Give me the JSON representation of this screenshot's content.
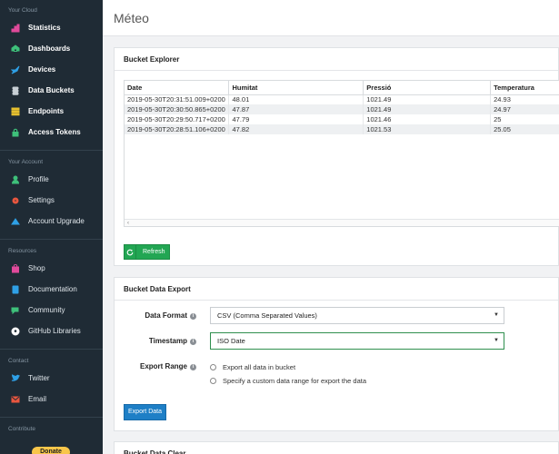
{
  "sidebar": {
    "your_cloud": {
      "title": "Your Cloud",
      "items": [
        {
          "label": "Statistics",
          "icon": "chart-icon",
          "color": "#e04a9b"
        },
        {
          "label": "Dashboards",
          "icon": "dashboard-icon",
          "color": "#3ec07a"
        },
        {
          "label": "Devices",
          "icon": "rocket-icon",
          "color": "#2fa0e6"
        },
        {
          "label": "Data Buckets",
          "icon": "database-icon",
          "color": "#c7cfd5"
        },
        {
          "label": "Endpoints",
          "icon": "list-icon",
          "color": "#e6c02f"
        },
        {
          "label": "Access Tokens",
          "icon": "lock-icon",
          "color": "#3ec07a"
        }
      ]
    },
    "your_account": {
      "title": "Your Account",
      "items": [
        {
          "label": "Profile",
          "icon": "user-icon",
          "color": "#3ec07a"
        },
        {
          "label": "Settings",
          "icon": "gear-icon",
          "color": "#e8563f"
        },
        {
          "label": "Account Upgrade",
          "icon": "upgrade-icon",
          "color": "#2fa0e6"
        }
      ]
    },
    "resources": {
      "title": "Resources",
      "items": [
        {
          "label": "Shop",
          "icon": "shop-icon",
          "color": "#e04a9b"
        },
        {
          "label": "Documentation",
          "icon": "book-icon",
          "color": "#2fa0e6"
        },
        {
          "label": "Community",
          "icon": "comments-icon",
          "color": "#3ec07a"
        },
        {
          "label": "GitHub Libraries",
          "icon": "github-icon",
          "color": "#ffffff"
        }
      ]
    },
    "contact": {
      "title": "Contact",
      "items": [
        {
          "label": "Twitter",
          "icon": "twitter-icon",
          "color": "#2fa0e6"
        },
        {
          "label": "Email",
          "icon": "envelope-icon",
          "color": "#e8563f"
        }
      ]
    },
    "contribute": {
      "title": "Contribute",
      "donate_label": "Donate"
    }
  },
  "page": {
    "title": "Méteo"
  },
  "bucket_explorer": {
    "title": "Bucket Explorer",
    "columns": [
      "Date",
      "Humitat",
      "Pressió",
      "Temperatura"
    ],
    "rows": [
      [
        "2019-05-30T20:31:51.009+0200",
        "48.01",
        "1021.49",
        "24.93"
      ],
      [
        "2019-05-30T20:30:50.865+0200",
        "47.87",
        "1021.49",
        "24.97"
      ],
      [
        "2019-05-30T20:29:50.717+0200",
        "47.79",
        "1021.46",
        "25"
      ],
      [
        "2019-05-30T20:28:51.106+0200",
        "47.82",
        "1021.53",
        "25.05"
      ]
    ],
    "scroll_arrow": "‹",
    "refresh_label": "Refresh"
  },
  "bucket_export": {
    "title": "Bucket Data Export",
    "data_format_label": "Data Format",
    "data_format_value": "CSV (Comma Separated Values)",
    "timestamp_label": "Timestamp",
    "timestamp_value": "ISO Date",
    "export_range_label": "Export Range",
    "range_option_all": "Export all data in bucket",
    "range_option_custom": "Specify a custom data range for export the data",
    "export_button_label": "Export Data"
  },
  "bucket_clear": {
    "title": "Bucket Data Clear"
  },
  "colors": {
    "sidebar_bg": "#1f2b35",
    "green": "#22a653",
    "blue": "#1e7fc6",
    "donate": "#f8c64a"
  }
}
